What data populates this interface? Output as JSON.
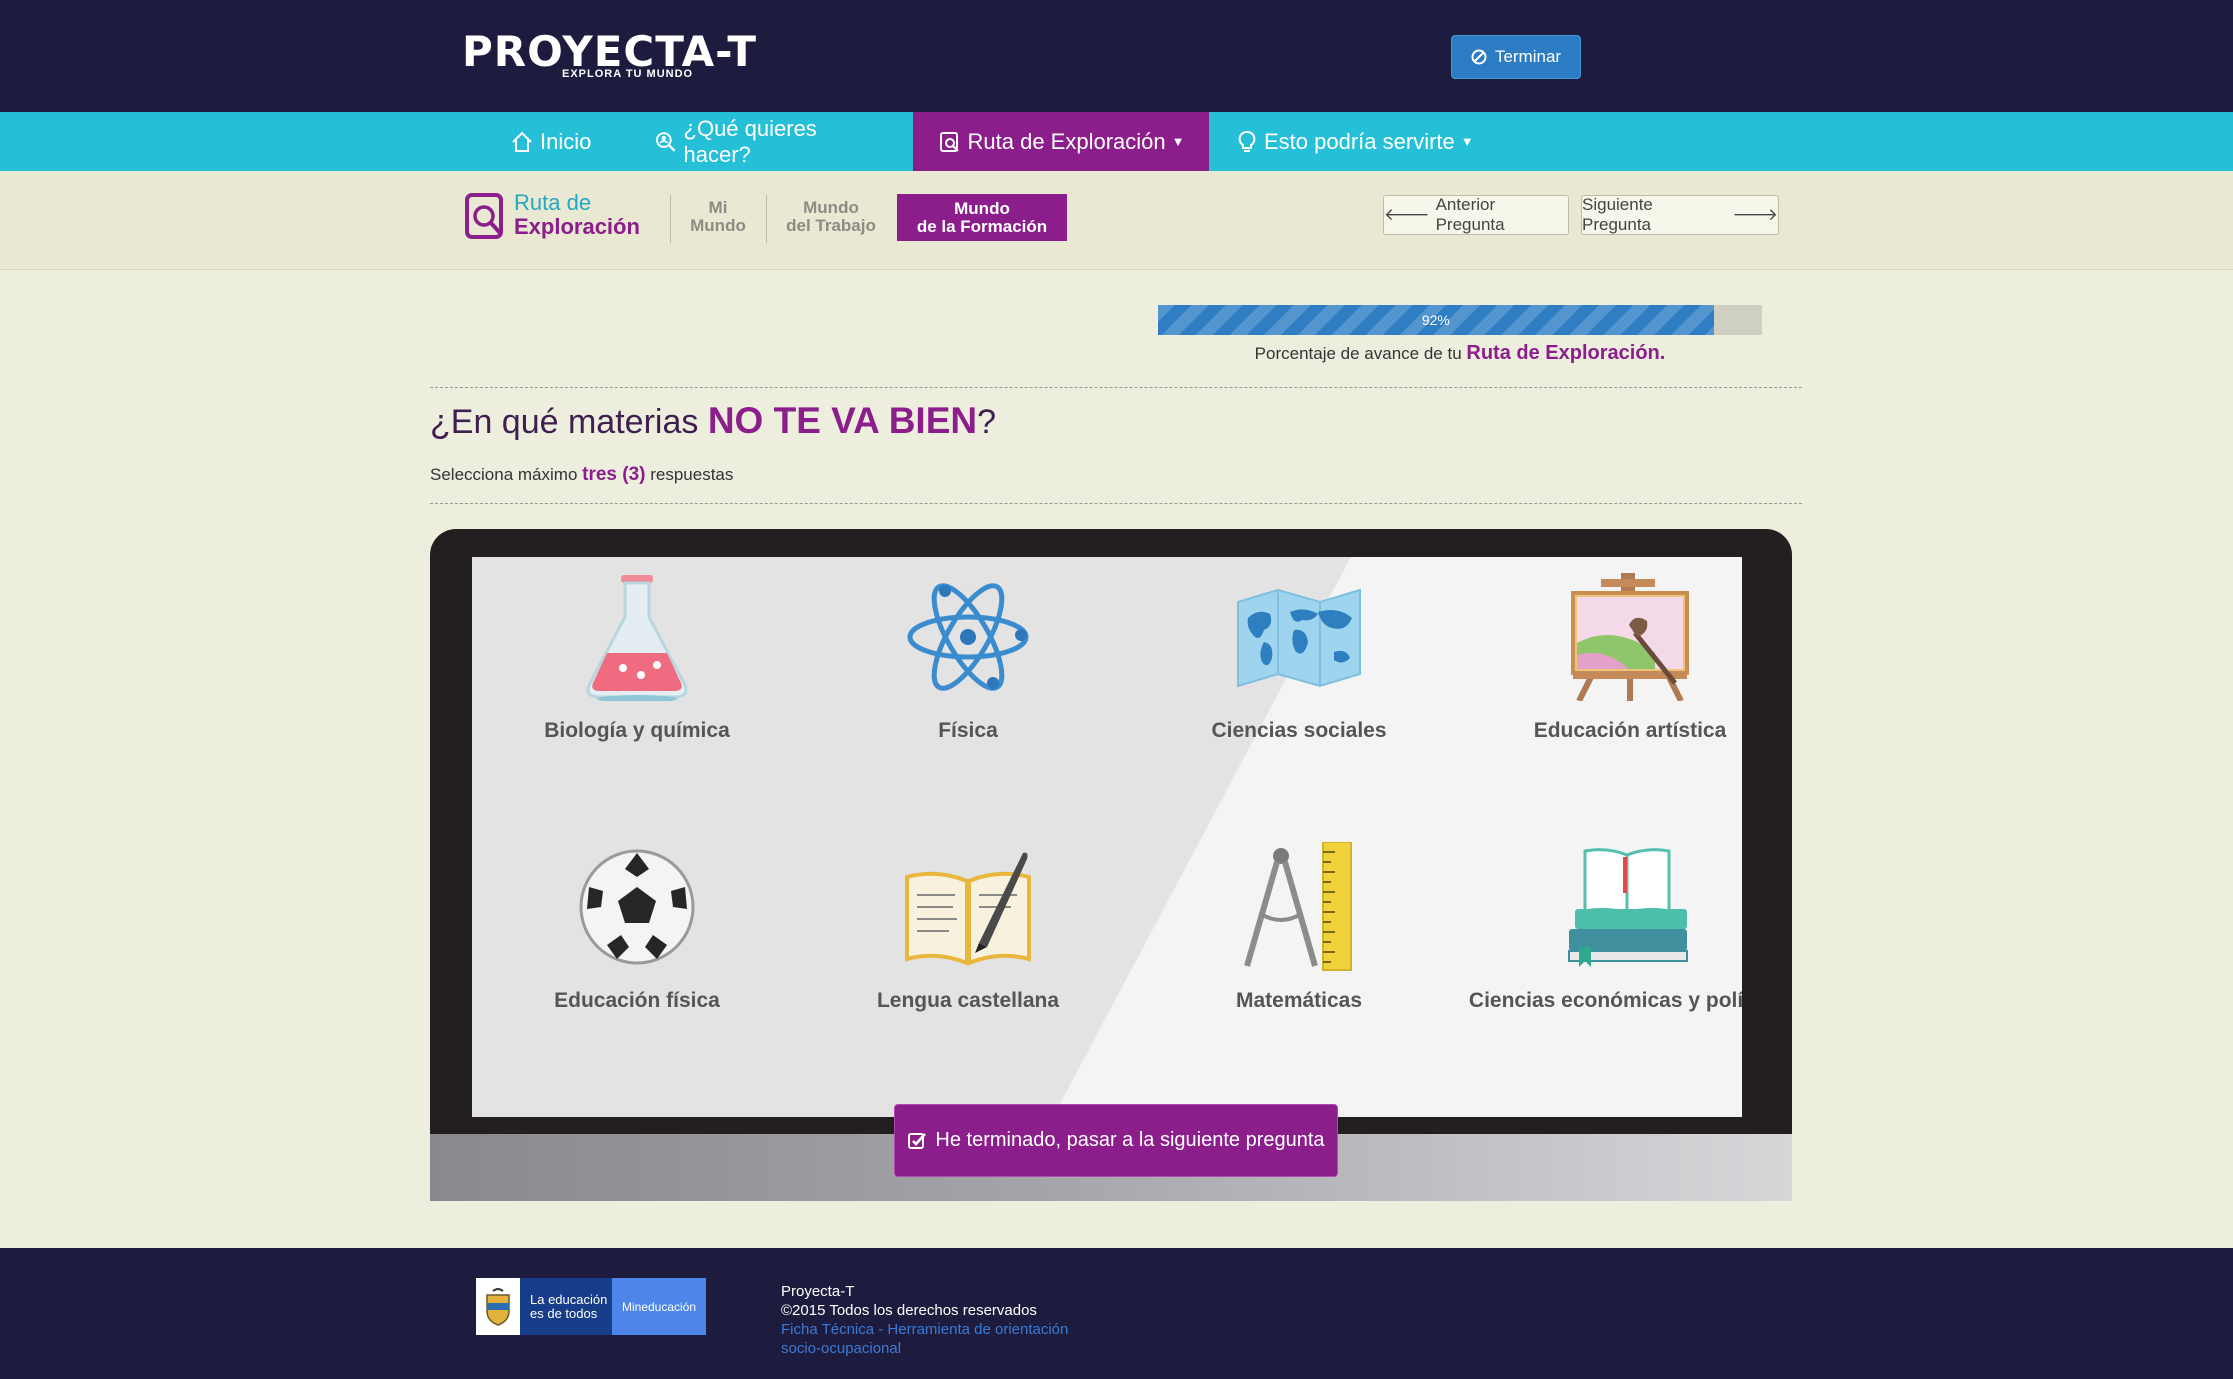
{
  "header": {
    "logo_text": "PROYECTA-T",
    "logo_tagline": "EXPLORA TU MUNDO",
    "terminar_label": "Terminar"
  },
  "nav": {
    "items": [
      {
        "label": "Inicio",
        "icon": "home-icon"
      },
      {
        "label": "¿Qué quieres hacer?",
        "icon": "search-person-icon"
      },
      {
        "label": "Ruta de Exploración",
        "icon": "magnifier-doc-icon",
        "active": true,
        "dropdown": true
      },
      {
        "label": "Esto podría servirte",
        "icon": "lightbulb-icon",
        "dropdown": true
      }
    ]
  },
  "subnav": {
    "logo_line1": "Ruta de",
    "logo_line2": "Exploración",
    "steps": [
      {
        "line1": "Mi",
        "line2": "Mundo"
      },
      {
        "line1": "Mundo",
        "line2": "del Trabajo"
      },
      {
        "line1": "Mundo",
        "line2": "de la Formación",
        "active": true
      }
    ],
    "prev_label": "Anterior Pregunta",
    "next_label": "Siguiente Pregunta"
  },
  "progress": {
    "value": 92,
    "label": "92%",
    "caption_prefix": "Porcentaje de avance de tu",
    "caption_highlight": "Ruta de Exploración."
  },
  "question": {
    "title_prefix": "¿En qué materias",
    "title_emphasis": "NO TE VA BIEN",
    "title_suffix": "?",
    "subtitle_prefix": "Selecciona máximo",
    "subtitle_emphasis": "tres (3)",
    "subtitle_suffix": "respuestas"
  },
  "options": [
    {
      "label": "Biología y química",
      "icon": "flask-icon"
    },
    {
      "label": "Física",
      "icon": "atom-icon"
    },
    {
      "label": "Ciencias sociales",
      "icon": "world-map-icon"
    },
    {
      "label": "Educación artística",
      "icon": "easel-icon"
    },
    {
      "label": "Educación física",
      "icon": "soccer-ball-icon"
    },
    {
      "label": "Lengua castellana",
      "icon": "book-quill-icon"
    },
    {
      "label": "Matemáticas",
      "icon": "compass-ruler-icon"
    },
    {
      "label": "Ciencias económicas y políticas",
      "icon": "books-icon"
    }
  ],
  "next_button_label": "He terminado, pasar a la siguiente pregunta",
  "footer": {
    "gov_line1": "La educación",
    "gov_line2": "es de todos",
    "gov_ministry": "Mineducación",
    "site": "Proyecta-T",
    "copyright": "©2015 Todos los derechos reservados",
    "link_line1": "Ficha Técnica - Herramienta de orientación",
    "link_line2": "socio-ocupacional"
  },
  "colors": {
    "header_bg": "#1d1c3e",
    "nav_bg": "#25c0d8",
    "accent_purple": "#8b1e8b",
    "progress_blue": "#2f7ec4",
    "page_bg": "#eeeedf"
  }
}
